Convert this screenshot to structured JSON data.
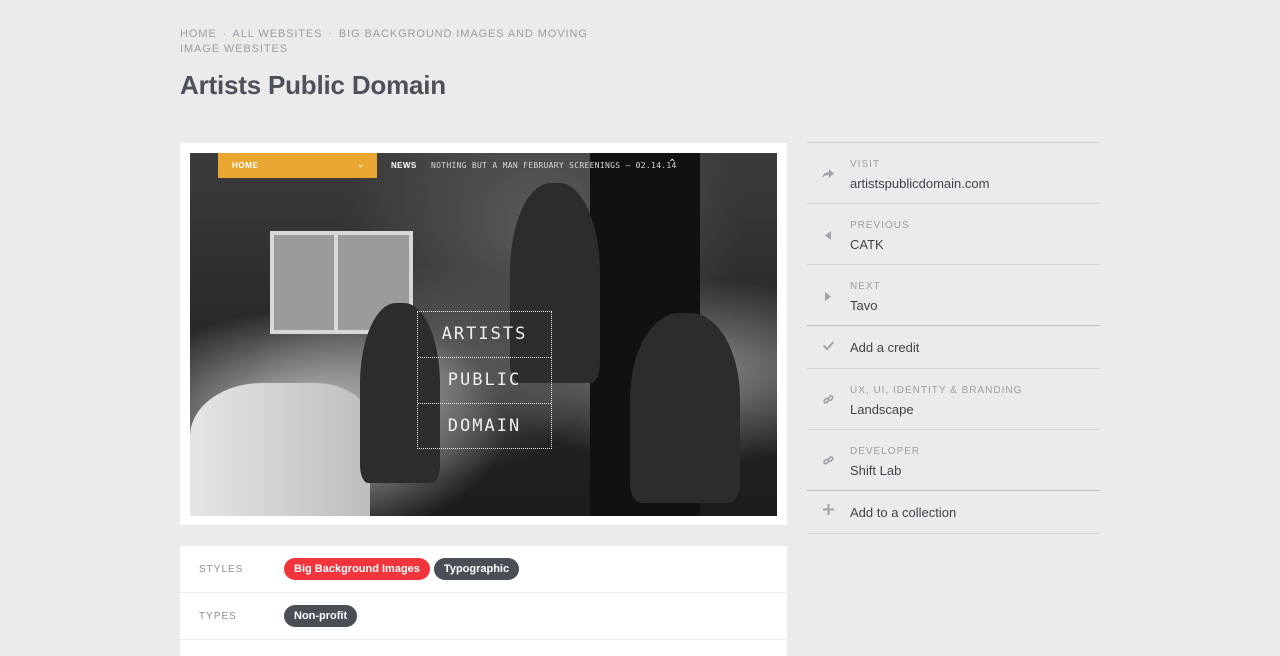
{
  "breadcrumb": {
    "home": "HOME",
    "all": "ALL WEBSITES",
    "category": "BIG BACKGROUND IMAGES AND MOVING IMAGE WEBSITES",
    "sep": "·"
  },
  "page": {
    "title": "Artists Public Domain"
  },
  "screenshot": {
    "nav_label": "HOME",
    "nav_chevron": "⌄",
    "news": "NEWS",
    "ticker": "NOTHING BUT A MAN FEBRUARY SCREENINGS – 02.14.14",
    "ticker_caret": "⌃",
    "logo_lines": [
      "ARTISTS",
      "PUBLIC",
      "DOMAIN"
    ]
  },
  "taxonomy": {
    "styles_label": "STYLES",
    "styles": [
      "Big Background Images",
      "Typographic"
    ],
    "types_label": "TYPES",
    "types": [
      "Non-profit"
    ]
  },
  "sidebar": {
    "visit": {
      "label": "VISIT",
      "value": "artistspublicdomain.com",
      "icon": "share-arrow-icon"
    },
    "previous": {
      "label": "PREVIOUS",
      "value": "CATK",
      "icon": "triangle-left-icon"
    },
    "next": {
      "label": "NEXT",
      "value": "Tavo",
      "icon": "triangle-right-icon"
    },
    "add_credit": {
      "value": "Add a credit",
      "icon": "check-icon"
    },
    "design": {
      "label": "UX, UI, IDENTITY & BRANDING",
      "value": "Landscape",
      "icon": "link-icon"
    },
    "developer": {
      "label": "DEVELOPER",
      "value": "Shift Lab",
      "icon": "link-icon"
    },
    "add_collection": {
      "value": "Add to a collection",
      "icon": "plus-icon"
    }
  },
  "colors": {
    "background": "#ebebeb",
    "accent_orange": "#e9a631",
    "tag_red": "#f2343c",
    "tag_dark": "#4a4f56"
  }
}
